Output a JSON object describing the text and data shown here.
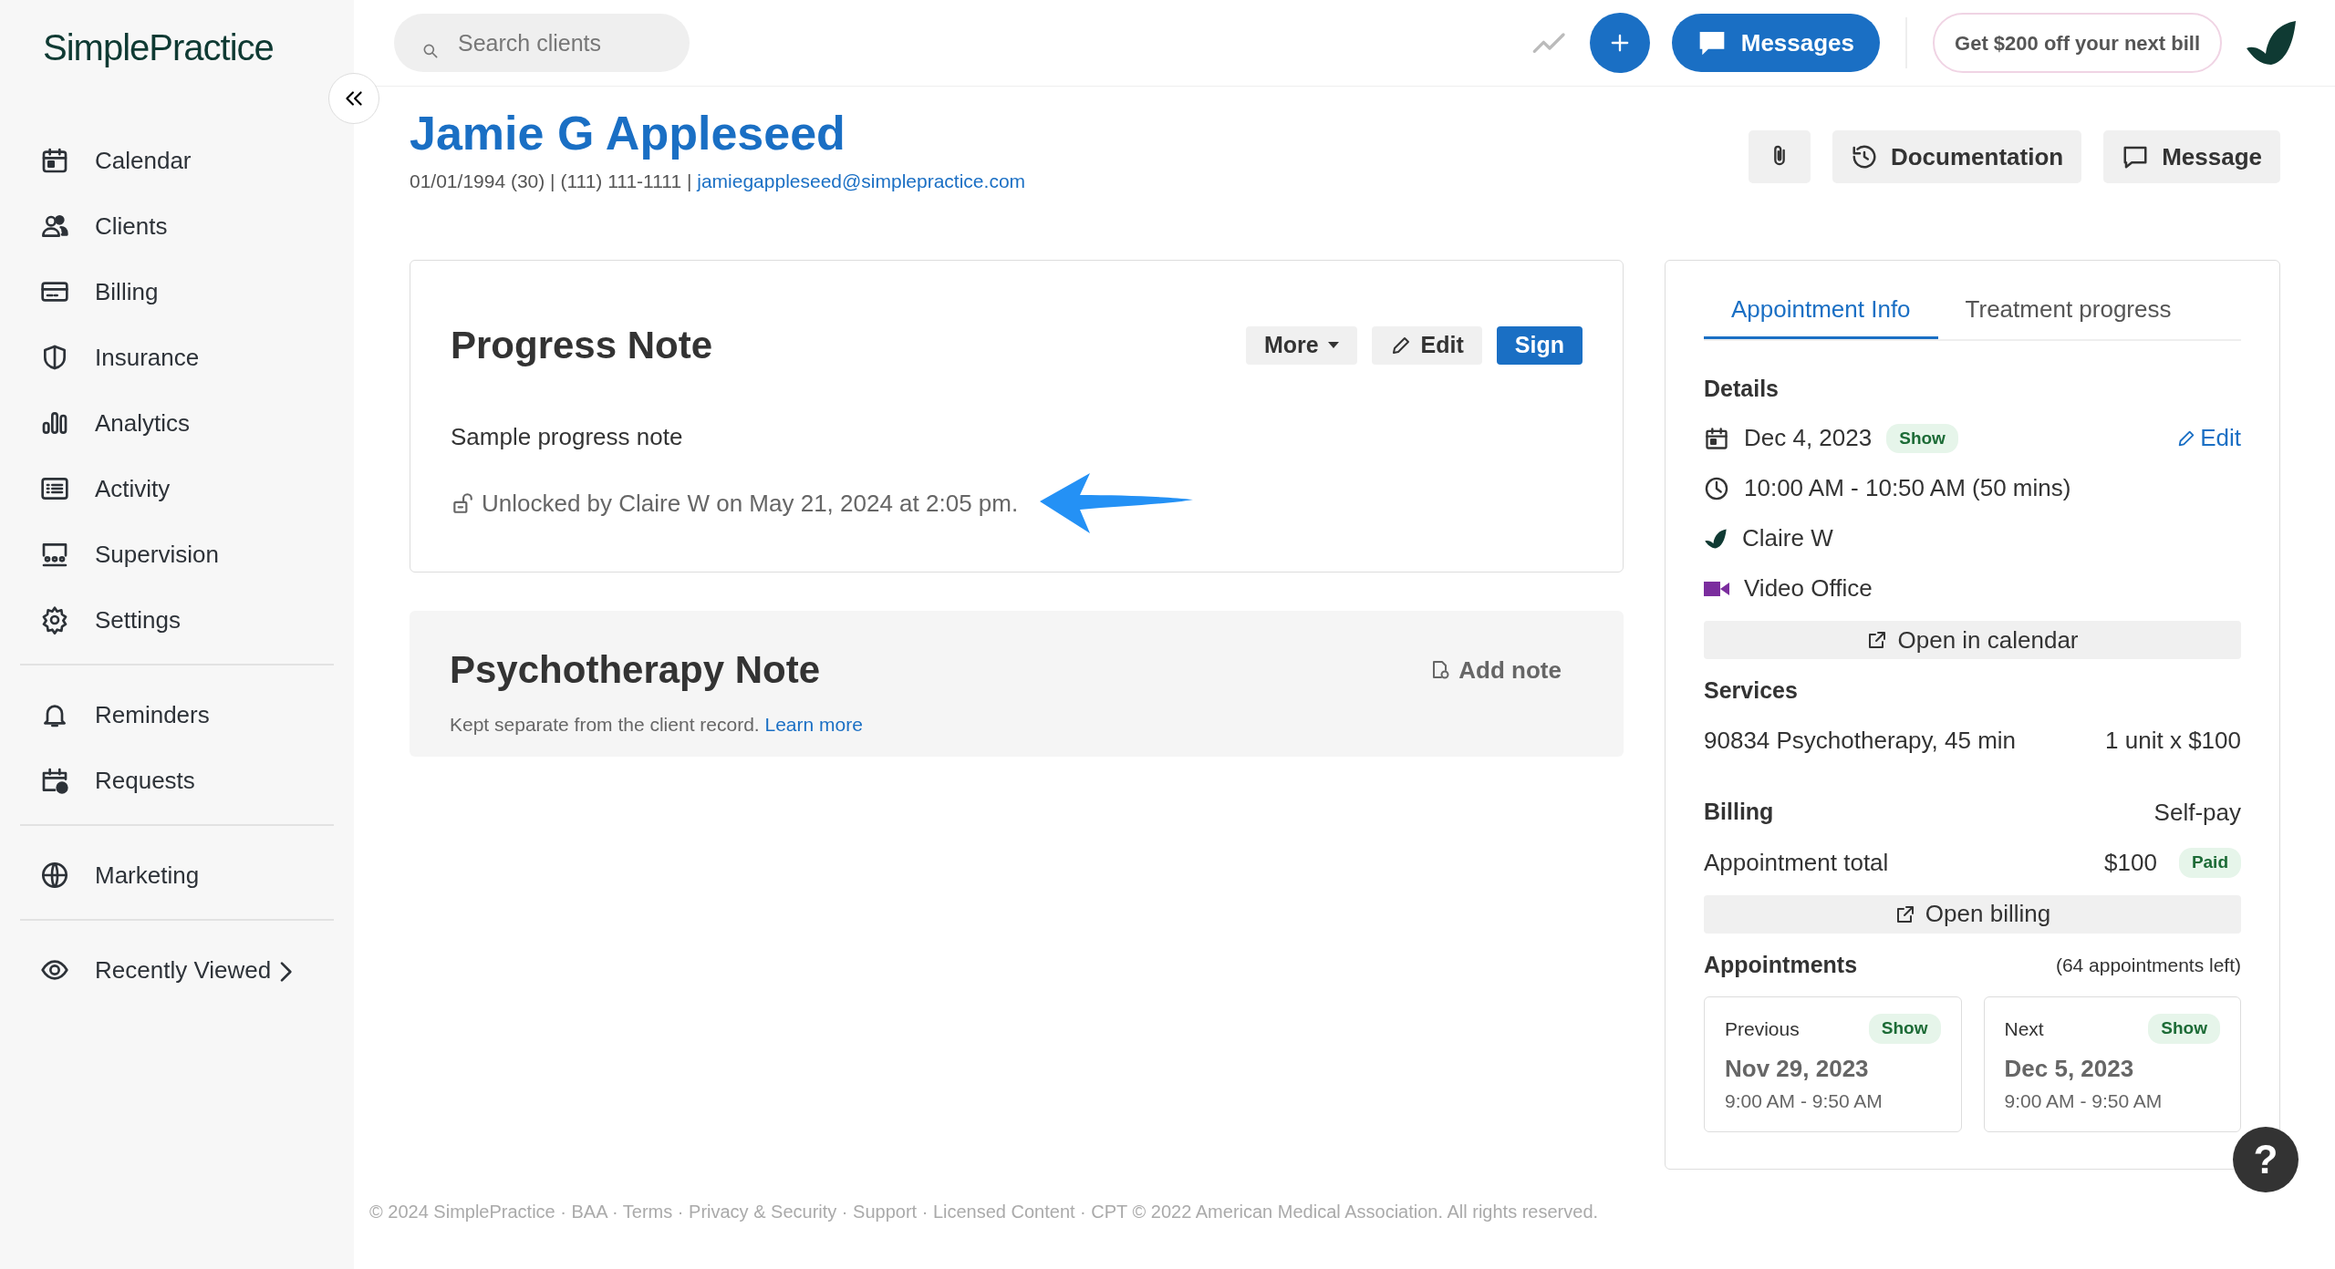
{
  "logo": {
    "text": "SimplePractice"
  },
  "sidebar": {
    "groups": [
      [
        {
          "label": "Calendar"
        },
        {
          "label": "Clients"
        },
        {
          "label": "Billing"
        },
        {
          "label": "Insurance"
        },
        {
          "label": "Analytics"
        },
        {
          "label": "Activity"
        },
        {
          "label": "Supervision"
        },
        {
          "label": "Settings"
        }
      ],
      [
        {
          "label": "Reminders"
        },
        {
          "label": "Requests"
        }
      ],
      [
        {
          "label": "Marketing"
        }
      ],
      [
        {
          "label": "Recently Viewed"
        }
      ]
    ]
  },
  "top_bar": {
    "search": {
      "placeholder": "Search clients"
    },
    "messages_button": "Messages",
    "promo_button": "Get $200 off your next bill"
  },
  "client": {
    "name": "Jamie G Appleseed",
    "meta": "01/01/1994 (30) | (111) 111-1111 | ",
    "email": "jamiegappleseed@simplepractice.com"
  },
  "header_buttons": [
    "Documentation",
    "Message"
  ],
  "progress_note": {
    "title": "Progress Note",
    "buttons": [
      {
        "label": "More",
        "kind": "dropdown"
      },
      {
        "label": "Edit",
        "kind": "edit"
      },
      {
        "label": "Sign",
        "kind": "primary"
      }
    ],
    "body": "Sample progress note",
    "unlock_text": "Unlocked by Claire W on May 21, 2024 at 2:05 pm."
  },
  "psychotherapy_note": {
    "title": "Psychotherapy Note",
    "action": "Add note",
    "description": "Kept separate from the client record.",
    "link": "Learn more"
  },
  "tabs": [
    {
      "label": "Appointment Info",
      "selected": true
    },
    {
      "label": "Treatment progress",
      "selected": false
    }
  ],
  "details": {
    "heading": "Details",
    "date": "Dec 4, 2023",
    "status": "Show",
    "edit": "Edit",
    "time": "10:00 AM - 10:50 AM (50 mins)",
    "clinician": "Claire W",
    "location": "Video Office",
    "open_button": "Open in calendar"
  },
  "services": {
    "heading": "Services",
    "name": "90834 Psychotherapy, 45 min",
    "units": "1 unit x $100"
  },
  "billing": {
    "heading": "Billing",
    "type": "Self-pay",
    "total_label": "Appointment total",
    "amount": "$100",
    "status": "Paid",
    "open_button": "Open billing"
  },
  "appointments": {
    "heading": "Appointments",
    "remaining": "(64 appointments left)",
    "cards": [
      {
        "label": "Previous",
        "status": "Show",
        "date": "Nov 29, 2023",
        "time": "9:00 AM - 9:50 AM"
      },
      {
        "label": "Next",
        "status": "Show",
        "date": "Dec 5, 2023",
        "time": "9:00 AM - 9:50 AM"
      }
    ]
  },
  "footer": "© 2024 SimplePractice · BAA · Terms · Privacy & Security · Support · Licensed Content · CPT © 2022 American Medical Association. All rights reserved.",
  "help_button": "?"
}
